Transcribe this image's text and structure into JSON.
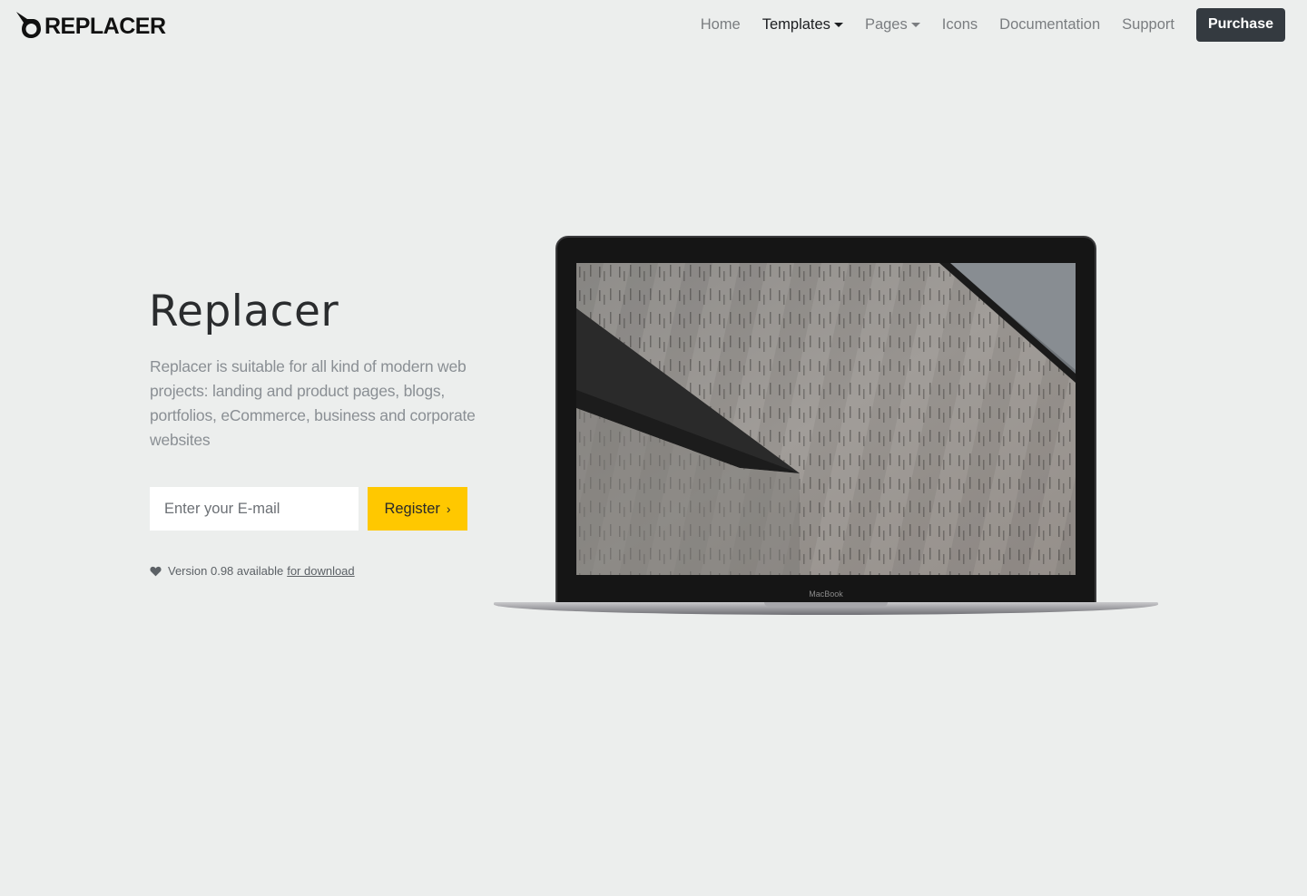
{
  "brand": {
    "name": "REPLACER"
  },
  "nav": {
    "items": [
      {
        "label": "Home",
        "dropdown": false,
        "active": false
      },
      {
        "label": "Templates",
        "dropdown": true,
        "active": true
      },
      {
        "label": "Pages",
        "dropdown": true,
        "active": false
      },
      {
        "label": "Icons",
        "dropdown": false,
        "active": false
      },
      {
        "label": "Documentation",
        "dropdown": false,
        "active": false
      },
      {
        "label": "Support",
        "dropdown": false,
        "active": false
      }
    ],
    "purchase_label": "Purchase"
  },
  "hero": {
    "title": "Replacer",
    "description": "Replacer is suitable for all kind of modern web projects: landing and product pages, blogs, portfolios, eCommerce, business and corporate websites",
    "email_placeholder": "Enter your E-mail",
    "register_label": "Register",
    "register_icon": "chevron-right-icon",
    "version_text": "Version 0.98 available",
    "download_link": "for download",
    "version_icon": "heart-icon"
  },
  "laptop": {
    "label": "MacBook"
  },
  "colors": {
    "background": "#eceeed",
    "accent": "#ffc800",
    "purchase_bg": "#343a40"
  }
}
